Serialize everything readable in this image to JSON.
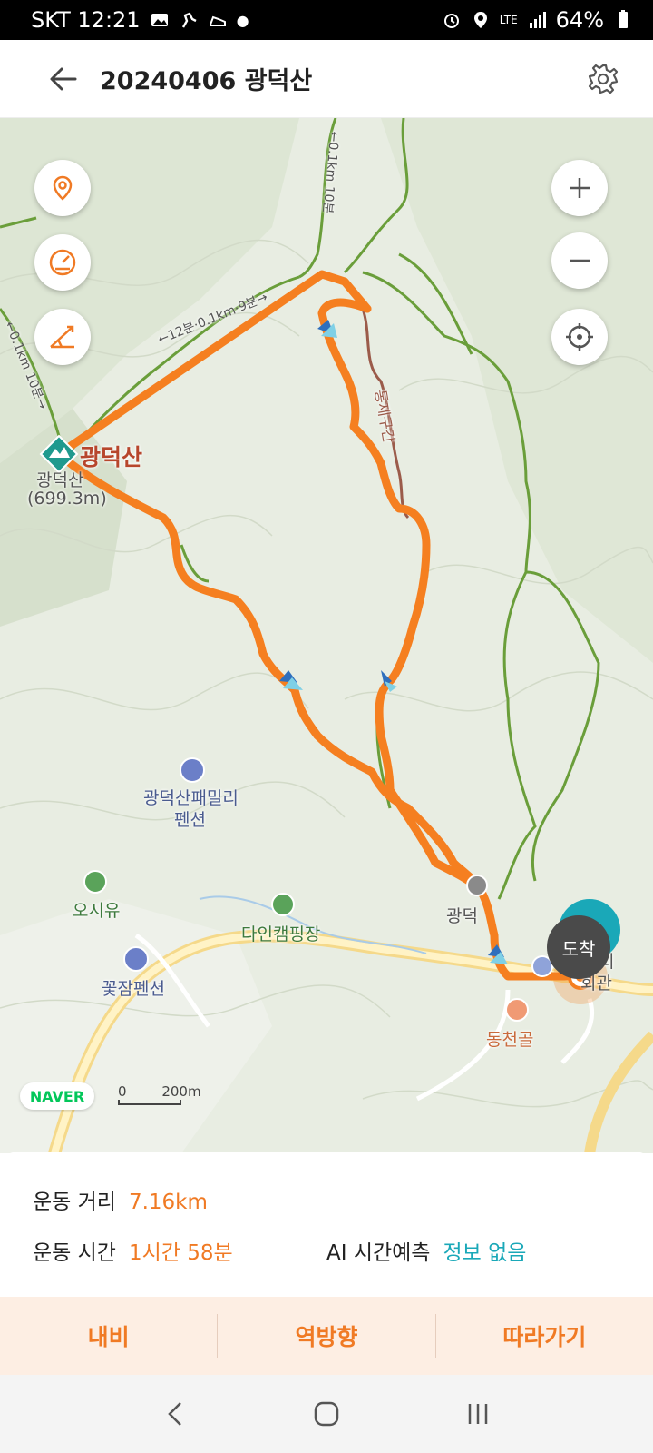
{
  "status_bar": {
    "carrier_time": "SKT 12:21",
    "network": "LTE",
    "battery": "64%",
    "icons": [
      "gallery-icon",
      "hiking-icon",
      "shoe-icon",
      "alarm-icon",
      "location-icon",
      "signal-icon",
      "battery-icon"
    ]
  },
  "app_bar": {
    "title": "20240406 광덕산"
  },
  "map": {
    "buttons": {
      "left": [
        "location-pin-icon",
        "speedometer-icon",
        "elevation-icon"
      ],
      "right": [
        "zoom-in-icon",
        "zoom-out-icon",
        "current-location-icon"
      ]
    },
    "peak": {
      "name": "광덕산",
      "label": "광덕산",
      "elevation": "(699.3m)"
    },
    "labels": {
      "pension1_line1": "광덕산패밀리",
      "pension1_line2": "펜션",
      "camp1": "오시유",
      "camp2": "다인캠핑장",
      "pension2": "꽃잠펜션",
      "restaurant": "동천골",
      "village": "광덕",
      "hall": "회관",
      "hall_prefix": "리",
      "trail_a": "←12분·0.1km·9분→",
      "trail_b": "←0.1km 10분→",
      "trail_c": "←0.1km 10분",
      "restricted": "통제구간"
    },
    "arrival_label": "도착",
    "brand": "NAVER",
    "scale_start": "0",
    "scale_end": "200m",
    "route_color": "#f57f20",
    "trail_color": "#6a9e3a"
  },
  "stats": {
    "distance_label": "운동 거리",
    "distance_value": "7.16km",
    "time_label": "운동 시간",
    "time_value": "1시간 58분",
    "ai_label": "AI 시간예측",
    "ai_value": "정보 없음"
  },
  "actions": {
    "navi": "내비",
    "reverse": "역방향",
    "follow": "따라가기"
  }
}
